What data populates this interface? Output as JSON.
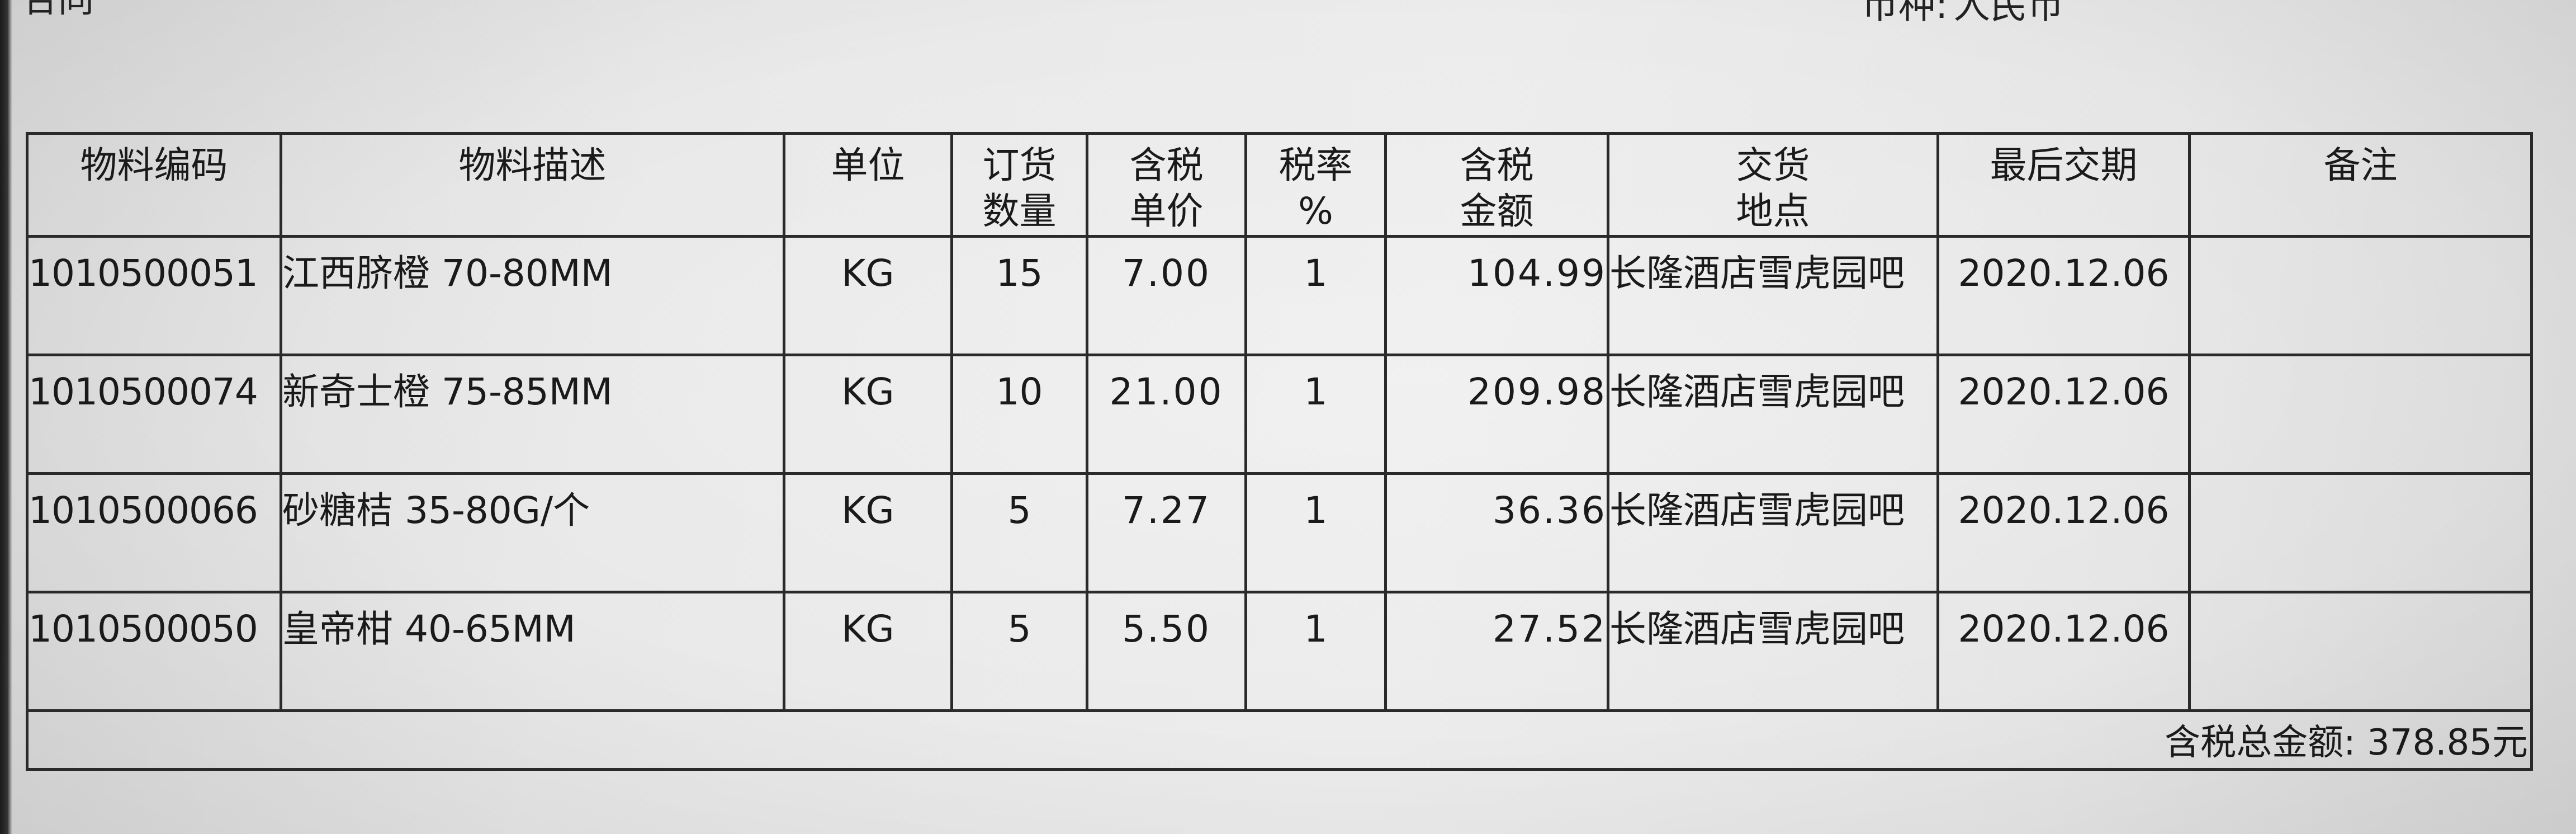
{
  "header": {
    "top_left_fragment": "合同",
    "currency_label": "币种:",
    "currency_value": "人民币"
  },
  "table": {
    "columns": {
      "code": "物料编码",
      "description": "物料描述",
      "unit": "单位",
      "quantity_line1": "订货",
      "quantity_line2": "数量",
      "price_line1": "含税",
      "price_line2": "单价",
      "tax_line1": "税率",
      "tax_line2": "%",
      "amount_line1": "含税",
      "amount_line2": "金额",
      "location_line1": "交货",
      "location_line2": "地点",
      "delivery_date": "最后交期",
      "remarks": "备注"
    },
    "rows": [
      {
        "code": "1010500051",
        "description": "江西脐橙 70-80MM",
        "unit": "KG",
        "quantity": "15",
        "price": "7.00",
        "tax": "1",
        "amount": "104.99",
        "location": "长隆酒店雪虎园吧",
        "delivery_date": "2020.12.06",
        "remarks": ""
      },
      {
        "code": "1010500074",
        "description": "新奇士橙 75-85MM",
        "unit": "KG",
        "quantity": "10",
        "price": "21.00",
        "tax": "1",
        "amount": "209.98",
        "location": "长隆酒店雪虎园吧",
        "delivery_date": "2020.12.06",
        "remarks": ""
      },
      {
        "code": "1010500066",
        "description": "砂糖桔 35-80G/个",
        "unit": "KG",
        "quantity": "5",
        "price": "7.27",
        "tax": "1",
        "amount": "36.36",
        "location": "长隆酒店雪虎园吧",
        "delivery_date": "2020.12.06",
        "remarks": ""
      },
      {
        "code": "1010500050",
        "description": "皇帝柑 40-65MM",
        "unit": "KG",
        "quantity": "5",
        "price": "5.50",
        "tax": "1",
        "amount": "27.52",
        "location": "长隆酒店雪虎园吧",
        "delivery_date": "2020.12.06",
        "remarks": ""
      }
    ],
    "total_label": "含税总金额:",
    "total_value": "378.85元"
  }
}
